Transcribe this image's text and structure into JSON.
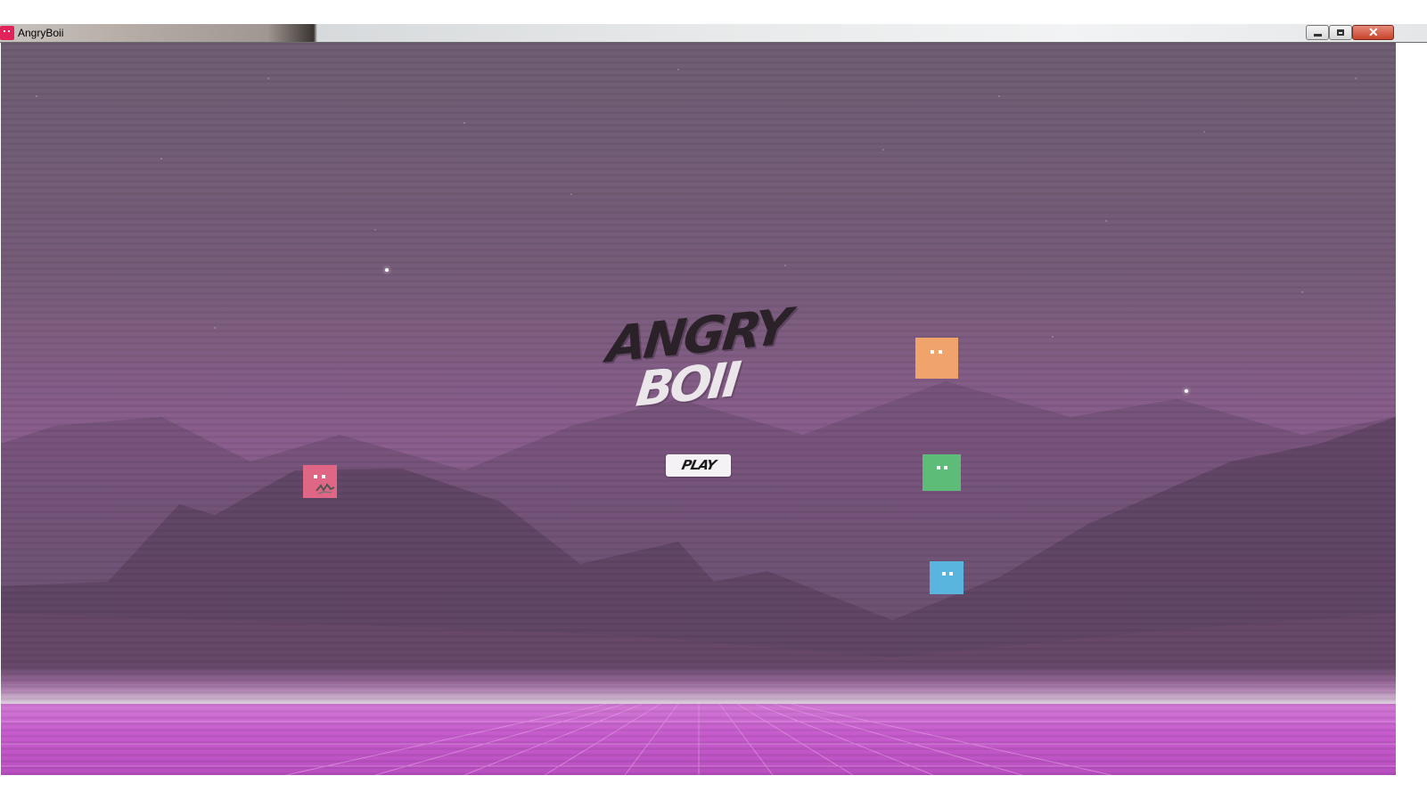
{
  "window": {
    "title": "AngryBoii",
    "controls": [
      "minimize-icon",
      "restore-icon",
      "close-icon"
    ],
    "close_glyph": "✕"
  },
  "game": {
    "logo": {
      "line1": "ANGRY",
      "line2": "BOII"
    },
    "play_button": {
      "label": "PLAY"
    },
    "characters": [
      {
        "name": "orange-boi",
        "color": "#f0a46c"
      },
      {
        "name": "green-boi",
        "color": "#5dbd78"
      },
      {
        "name": "blue-boi",
        "color": "#59b5dd"
      },
      {
        "name": "pink-boi",
        "color": "#e06685"
      }
    ]
  },
  "colors": {
    "sky_top": "#6f5e74",
    "sky_glow": "#8b5e8e",
    "floor": "#c65ccd",
    "horizon": "#ebe2ec",
    "app_icon": "#e0245a"
  }
}
